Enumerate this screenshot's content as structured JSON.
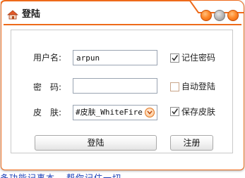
{
  "window": {
    "title": "登陆",
    "accent_color": "#ee6a1a"
  },
  "icons": {
    "app": "house-icon",
    "dropdown": "chevron-down-icon",
    "check": "checkmark-icon"
  },
  "form": {
    "username": {
      "label": "用户名:",
      "value": "arpun"
    },
    "password": {
      "label": "密　码:",
      "value": ""
    },
    "skin": {
      "label": "皮　肤:",
      "selected": "#皮肤_WhiteFire"
    }
  },
  "options": {
    "remember_password": {
      "label": "记住密码",
      "checked": true
    },
    "auto_login": {
      "label": "自动登陆",
      "checked": false
    },
    "save_skin": {
      "label": "保存皮肤",
      "checked": true
    }
  },
  "buttons": {
    "login": "登陆",
    "register": "注册"
  },
  "background_link": "多功能记事本---帮你记住一切"
}
